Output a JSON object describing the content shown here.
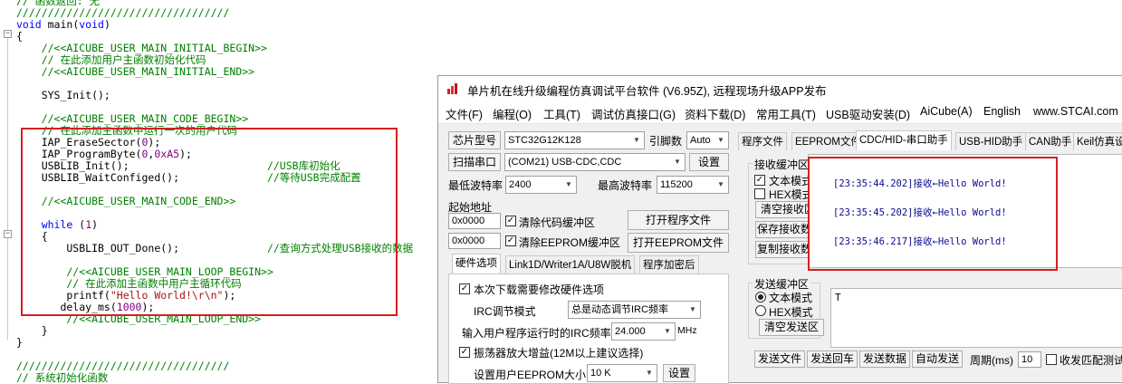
{
  "editor": {
    "lines": [
      {
        "tokens": [
          {
            "t": "// 函数返回: 无",
            "c": "c"
          }
        ]
      },
      {
        "tokens": [
          {
            "t": "//////////////////////////////////",
            "c": "c"
          }
        ]
      },
      {
        "tokens": [
          {
            "t": "void",
            "c": "k"
          },
          {
            "t": " main(",
            "c": "t"
          },
          {
            "t": "void",
            "c": "k"
          },
          {
            "t": ")",
            "c": "t"
          }
        ]
      },
      {
        "tokens": [
          {
            "t": "{",
            "c": "t"
          }
        ]
      },
      {
        "tokens": [
          {
            "t": "    //<<AICUBE_USER_MAIN_INITIAL_BEGIN>>",
            "c": "c"
          }
        ]
      },
      {
        "tokens": [
          {
            "t": "    // 在此添加用户主函数初始化代码",
            "c": "c"
          }
        ]
      },
      {
        "tokens": [
          {
            "t": "    //<<AICUBE_USER_MAIN_INITIAL_END>>",
            "c": "c"
          }
        ]
      },
      {
        "tokens": [
          {
            "t": "",
            "c": "t"
          }
        ]
      },
      {
        "tokens": [
          {
            "t": "    SYS_Init();",
            "c": "t"
          }
        ]
      },
      {
        "tokens": [
          {
            "t": "",
            "c": "t"
          }
        ]
      },
      {
        "tokens": [
          {
            "t": "    //<<AICUBE_USER_MAIN_CODE_BEGIN>>",
            "c": "c"
          }
        ]
      },
      {
        "tokens": [
          {
            "t": "    // 在此添加主函数中运行一次的用户代码",
            "c": "c"
          }
        ]
      },
      {
        "tokens": [
          {
            "t": "    IAP_EraseSector(",
            "c": "t"
          },
          {
            "t": "0",
            "c": "n"
          },
          {
            "t": ");",
            "c": "t"
          }
        ]
      },
      {
        "tokens": [
          {
            "t": "    IAP_ProgramByte(",
            "c": "t"
          },
          {
            "t": "0",
            "c": "n"
          },
          {
            "t": ",",
            "c": "t"
          },
          {
            "t": "0xA5",
            "c": "n"
          },
          {
            "t": ");",
            "c": "t"
          }
        ]
      },
      {
        "tokens": [
          {
            "t": "    USBLIB_Init();                      ",
            "c": "t"
          },
          {
            "t": "//USB库初始化",
            "c": "c"
          }
        ]
      },
      {
        "tokens": [
          {
            "t": "    USBLIB_WaitConfiged();              ",
            "c": "t"
          },
          {
            "t": "//等待USB完成配置",
            "c": "c"
          }
        ]
      },
      {
        "tokens": [
          {
            "t": "",
            "c": "t"
          }
        ]
      },
      {
        "tokens": [
          {
            "t": "    //<<AICUBE_USER_MAIN_CODE_END>>",
            "c": "c"
          }
        ]
      },
      {
        "tokens": [
          {
            "t": "",
            "c": "t"
          }
        ]
      },
      {
        "tokens": [
          {
            "t": "    ",
            "c": "t"
          },
          {
            "t": "while",
            "c": "k"
          },
          {
            "t": " (",
            "c": "t"
          },
          {
            "t": "1",
            "c": "n"
          },
          {
            "t": ")",
            "c": "t"
          }
        ]
      },
      {
        "tokens": [
          {
            "t": "    {",
            "c": "t"
          }
        ]
      },
      {
        "tokens": [
          {
            "t": "        USBLIB_OUT_Done();              ",
            "c": "t"
          },
          {
            "t": "//查询方式处理USB接收的数据",
            "c": "c"
          }
        ]
      },
      {
        "tokens": [
          {
            "t": "",
            "c": "t"
          }
        ]
      },
      {
        "tokens": [
          {
            "t": "        //<<AICUBE_USER_MAIN_LOOP_BEGIN>>",
            "c": "c"
          }
        ]
      },
      {
        "tokens": [
          {
            "t": "        // 在此添加主函数中用户主循环代码",
            "c": "c"
          }
        ]
      },
      {
        "tokens": [
          {
            "t": "        printf(",
            "c": "t"
          },
          {
            "t": "\"Hello World!\\r\\n\"",
            "c": "s"
          },
          {
            "t": ");",
            "c": "t"
          }
        ]
      },
      {
        "tokens": [
          {
            "t": "       delay_ms(",
            "c": "t"
          },
          {
            "t": "1000",
            "c": "n"
          },
          {
            "t": ");",
            "c": "t"
          }
        ]
      },
      {
        "tokens": [
          {
            "t": "        //<<AICUBE_USER_MAIN_LOOP_END>>",
            "c": "c"
          }
        ]
      },
      {
        "tokens": [
          {
            "t": "    }",
            "c": "t"
          }
        ]
      },
      {
        "tokens": [
          {
            "t": "}",
            "c": "t"
          }
        ]
      },
      {
        "tokens": [
          {
            "t": "",
            "c": "t"
          }
        ]
      },
      {
        "tokens": [
          {
            "t": "//////////////////////////////////",
            "c": "c"
          }
        ]
      },
      {
        "tokens": [
          {
            "t": "// 系统初始化函数",
            "c": "c"
          }
        ]
      }
    ],
    "colors": {
      "keyword": "#0000ff",
      "text": "#000000",
      "comment": "#008000",
      "number": "#800080",
      "string": "#a31515",
      "highlight": "#d32020"
    }
  },
  "window": {
    "title": "单片机在线升级编程仿真调试平台软件 (V6.95Z), 远程现场升级APP发布",
    "menu": [
      "文件(F)",
      "编程(O)",
      "工具(T)",
      "调试仿真接口(G)",
      "资料下载(D)",
      "常用工具(T)",
      "USB驱动安装(D)",
      "AiCube(A)",
      "English",
      "www.STCAI.com"
    ],
    "left": {
      "chip_button": "芯片型号",
      "chip_value": "STC32G12K128",
      "pin_label": "引脚数",
      "pin_value": "Auto",
      "scan_button": "扫描串口",
      "port_value": "(COM21) USB-CDC,CDC",
      "settings_button": "设置",
      "min_baud_label": "最低波特率",
      "min_baud_value": "2400",
      "max_baud_label": "最高波特率",
      "max_baud_value": "115200",
      "start_addr_label": "起始地址",
      "addr1": "0x0000",
      "addr2": "0x0000",
      "clear_code": "清除代码缓冲区",
      "clear_eeprom": "清除EEPROM缓冲区",
      "open_program": "打开程序文件",
      "open_eeprom": "打开EEPROM文件",
      "tabs": [
        "硬件选项",
        "Link1D/Writer1A/U8W脱机",
        "程序加密后"
      ],
      "hw_change": "本次下载需要修改硬件选项",
      "irc_label": "IRC调节模式",
      "irc_value": "总是动态调节IRC频率",
      "irc_freq_label": "输入用户程序运行时的IRC频率",
      "irc_freq_value": "24.000",
      "irc_unit": "MHz",
      "osc_gain": "振荡器放大增益(12M以上建议选择)",
      "eeprom_size_label": "设置用户EEPROM大小",
      "eeprom_size_value": "10 K",
      "eeprom_size_btn": "设置"
    },
    "right": {
      "tabs": [
        "程序文件",
        "EEPROM文件",
        "CDC/HID-串口助手",
        "USB-HID助手",
        "CAN助手",
        "Keil仿真设"
      ],
      "recv_group": "接收缓冲区",
      "text_mode": "文本模式",
      "hex_mode": "HEX模式",
      "clear_recv": "清空接收区",
      "save_recv": "保存接收数据",
      "copy_recv": "复制接收数据",
      "recv_lines": [
        "[23:35:44.202]接收←Hello World!",
        "[23:35:45.202]接收←Hello World!",
        "[23:35:46.217]接收←Hello World!"
      ],
      "send_group": "发送缓冲区",
      "send_text_mode": "文本模式",
      "send_hex_mode": "HEX模式",
      "clear_send": "清空发送区",
      "send_content": "T",
      "send_file": "发送文件",
      "send_return": "发送回车",
      "send_data": "发送数据",
      "auto_send": "自动发送",
      "period_label": "周期(ms)",
      "period_value": "10",
      "match_label": "收发匹配测试"
    }
  }
}
